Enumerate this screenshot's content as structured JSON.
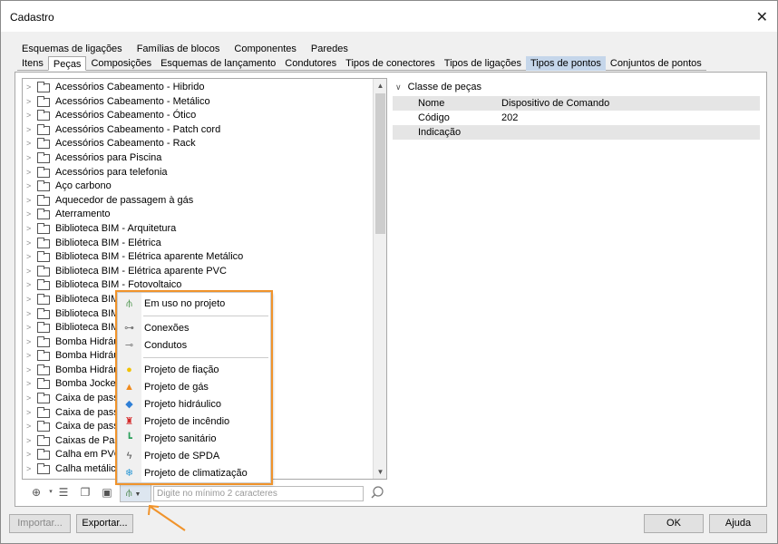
{
  "window": {
    "title": "Cadastro",
    "close_glyph": "✕"
  },
  "tabs_row1": [
    "Esquemas de ligações",
    "Famílias de blocos",
    "Componentes",
    "Paredes"
  ],
  "tabs_row2": [
    "Itens",
    "Peças",
    "Composições",
    "Esquemas de lançamento",
    "Condutores",
    "Tipos de conectores",
    "Tipos de ligações",
    "Tipos de pontos",
    "Conjuntos de pontos"
  ],
  "tabs_row2_active": "Peças",
  "tabs_row2_selected": "Tipos de pontos",
  "tree_items": [
    "Acessórios Cabeamento - Hibrido",
    "Acessórios Cabeamento - Metálico",
    "Acessórios Cabeamento - Ótico",
    "Acessórios Cabeamento - Patch cord",
    "Acessórios Cabeamento - Rack",
    "Acessórios para Piscina",
    "Acessórios para telefonia",
    "Aço carbono",
    "Aquecedor de passagem à gás",
    "Aterramento",
    "Biblioteca BIM - Arquitetura",
    "Biblioteca BIM - Elétrica",
    "Biblioteca BIM - Elétrica aparente Metálico",
    "Biblioteca BIM - Elétrica aparente PVC",
    "Biblioteca BIM - Fotovoltaico",
    "Biblioteca BIM -",
    "Biblioteca BIM -",
    "Biblioteca BIM -",
    "Bomba Hidráulic",
    "Bomba Hidráuli",
    "Bomba Hidráuli",
    "Bomba Jockey",
    "Caixa de passag",
    "Caixa de passag",
    "Caixa de passag",
    "Caixas de Passa",
    "Calha em PVC",
    "Calha metálica"
  ],
  "properties": {
    "header": "Classe de peças",
    "rows": [
      {
        "key": "Nome",
        "value": "Dispositivo de Comando"
      },
      {
        "key": "Código",
        "value": "202"
      },
      {
        "key": "Indicação",
        "value": ""
      }
    ]
  },
  "search": {
    "placeholder": "Digite no mínimo 2 caracteres"
  },
  "popup_menu": {
    "groups": [
      [
        {
          "label": "Em uso no projeto",
          "icon": "filter-icon",
          "color": "#3a8a3a"
        }
      ],
      [
        {
          "label": "Conexões",
          "icon": "connection-icon",
          "color": "#777777"
        },
        {
          "label": "Condutos",
          "icon": "conduit-icon",
          "color": "#777777"
        }
      ],
      [
        {
          "label": "Projeto de fiação",
          "icon": "lightbulb-icon",
          "color": "#f2c200"
        },
        {
          "label": "Projeto de gás",
          "icon": "flame-icon",
          "color": "#f08a1c"
        },
        {
          "label": "Projeto hidráulico",
          "icon": "water-drop-icon",
          "color": "#2f7fd6"
        },
        {
          "label": "Projeto de incêndio",
          "icon": "fire-hydrant-icon",
          "color": "#d42a2a"
        },
        {
          "label": "Projeto sanitário",
          "icon": "pipe-icon",
          "color": "#2aa05a"
        },
        {
          "label": "Projeto de SPDA",
          "icon": "lightning-icon",
          "color": "#555555"
        },
        {
          "label": "Projeto de climatização",
          "icon": "snowflake-icon",
          "color": "#2f9ad6"
        }
      ]
    ]
  },
  "buttons": {
    "importar": "Importar...",
    "exportar": "Exportar...",
    "ok": "OK",
    "ajuda": "Ajuda"
  },
  "colors": {
    "highlight_orange": "#f0932b",
    "tab_selected": "#c5d6ea"
  }
}
